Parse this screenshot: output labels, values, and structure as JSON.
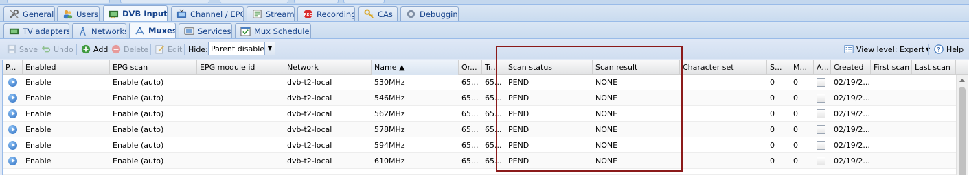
{
  "top_tabs": [
    {
      "label": "General",
      "icon": "wrench-icon",
      "active": false
    },
    {
      "label": "Users",
      "icon": "users-icon",
      "active": false
    },
    {
      "label": "DVB Inputs",
      "icon": "dvb-card-icon",
      "active": true
    },
    {
      "label": "Channel / EPG",
      "icon": "tv-icon",
      "active": false
    },
    {
      "label": "Stream",
      "icon": "stream-icon",
      "active": false
    },
    {
      "label": "Recording",
      "icon": "rec-icon",
      "active": false
    },
    {
      "label": "CAs",
      "icon": "key-icon",
      "active": false
    },
    {
      "label": "Debugging",
      "icon": "bug-icon",
      "active": false
    }
  ],
  "sub_tabs": [
    {
      "label": "TV adapters",
      "icon": "tv-card-icon",
      "active": false
    },
    {
      "label": "Networks",
      "icon": "antenna-icon",
      "active": false
    },
    {
      "label": "Muxes",
      "icon": "mux-icon",
      "active": true
    },
    {
      "label": "Services",
      "icon": "services-icon",
      "active": false
    },
    {
      "label": "Mux Schedulers",
      "icon": "calendar-icon",
      "active": false
    }
  ],
  "toolbar": {
    "save_label": "Save",
    "undo_label": "Undo",
    "add_label": "Add",
    "delete_label": "Delete",
    "edit_label": "Edit",
    "hide_label": "Hide:",
    "hide_value": "Parent disablec",
    "view_level_label": "View level: Expert",
    "help_label": "Help"
  },
  "columns": [
    "P...",
    "Enabled",
    "EPG scan",
    "EPG module id",
    "Network",
    "Name ▲",
    "Or...",
    "Tr...",
    "Scan status",
    "Scan result",
    "Character set",
    "S...",
    "M...",
    "A...",
    "Created",
    "First scan",
    "Last scan"
  ],
  "rows": [
    {
      "enabled": "Enable",
      "epg_scan": "Enable (auto)",
      "epg_module": "",
      "network": "dvb-t2-local",
      "name": "530MHz",
      "orig": "65...",
      "tr": "65...",
      "scan_status": "PEND",
      "scan_result": "NONE",
      "charset": "",
      "s": "0",
      "m": "0",
      "created": "02/19/2..."
    },
    {
      "enabled": "Enable",
      "epg_scan": "Enable (auto)",
      "epg_module": "",
      "network": "dvb-t2-local",
      "name": "546MHz",
      "orig": "65...",
      "tr": "65...",
      "scan_status": "PEND",
      "scan_result": "NONE",
      "charset": "",
      "s": "0",
      "m": "0",
      "created": "02/19/2..."
    },
    {
      "enabled": "Enable",
      "epg_scan": "Enable (auto)",
      "epg_module": "",
      "network": "dvb-t2-local",
      "name": "562MHz",
      "orig": "65...",
      "tr": "65...",
      "scan_status": "PEND",
      "scan_result": "NONE",
      "charset": "",
      "s": "0",
      "m": "0",
      "created": "02/19/2..."
    },
    {
      "enabled": "Enable",
      "epg_scan": "Enable (auto)",
      "epg_module": "",
      "network": "dvb-t2-local",
      "name": "578MHz",
      "orig": "65...",
      "tr": "65...",
      "scan_status": "PEND",
      "scan_result": "NONE",
      "charset": "",
      "s": "0",
      "m": "0",
      "created": "02/19/2..."
    },
    {
      "enabled": "Enable",
      "epg_scan": "Enable (auto)",
      "epg_module": "",
      "network": "dvb-t2-local",
      "name": "594MHz",
      "orig": "65...",
      "tr": "65...",
      "scan_status": "PEND",
      "scan_result": "NONE",
      "charset": "",
      "s": "0",
      "m": "0",
      "created": "02/19/2..."
    },
    {
      "enabled": "Enable",
      "epg_scan": "Enable (auto)",
      "epg_module": "",
      "network": "dvb-t2-local",
      "name": "610MHz",
      "orig": "65...",
      "tr": "65...",
      "scan_status": "PEND",
      "scan_result": "NONE",
      "charset": "",
      "s": "0",
      "m": "0",
      "created": "02/19/2..."
    }
  ],
  "colors": {
    "highlight_border": "#8b1a1a",
    "tab_text": "#15428b"
  }
}
